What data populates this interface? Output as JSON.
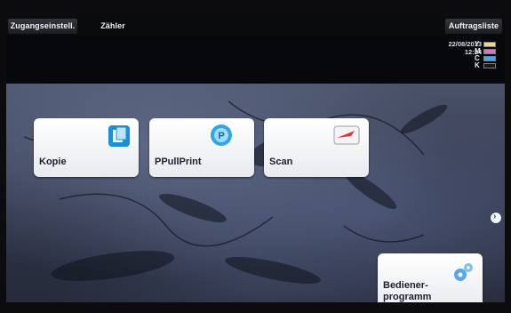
{
  "topbar": {
    "access_settings_label": "Zugangseinstell.",
    "counter_label": "Zähler",
    "job_list_label": "Auftragsliste"
  },
  "status": {
    "date": "22/08/2013",
    "time": "12:24",
    "toner": [
      {
        "label": "Y",
        "color": "#f2d58a"
      },
      {
        "label": "M",
        "color": "#d07bb8"
      },
      {
        "label": "C",
        "color": "#4aa6e8"
      },
      {
        "label": "K",
        "color": "#1a1a1a"
      }
    ]
  },
  "tiles": {
    "copy_label": "Kopie",
    "ppullprint_label": "PPullPrint",
    "scan_label": "Scan",
    "user_program_label_line1": "Bediener-",
    "user_program_label_line2": "programm"
  },
  "icons": {
    "copy": "copy-icon",
    "ppullprint": "ppullprint-icon",
    "scan": "scan-icon",
    "user_program": "gears-icon",
    "next_page": "chevron-right-icon"
  }
}
